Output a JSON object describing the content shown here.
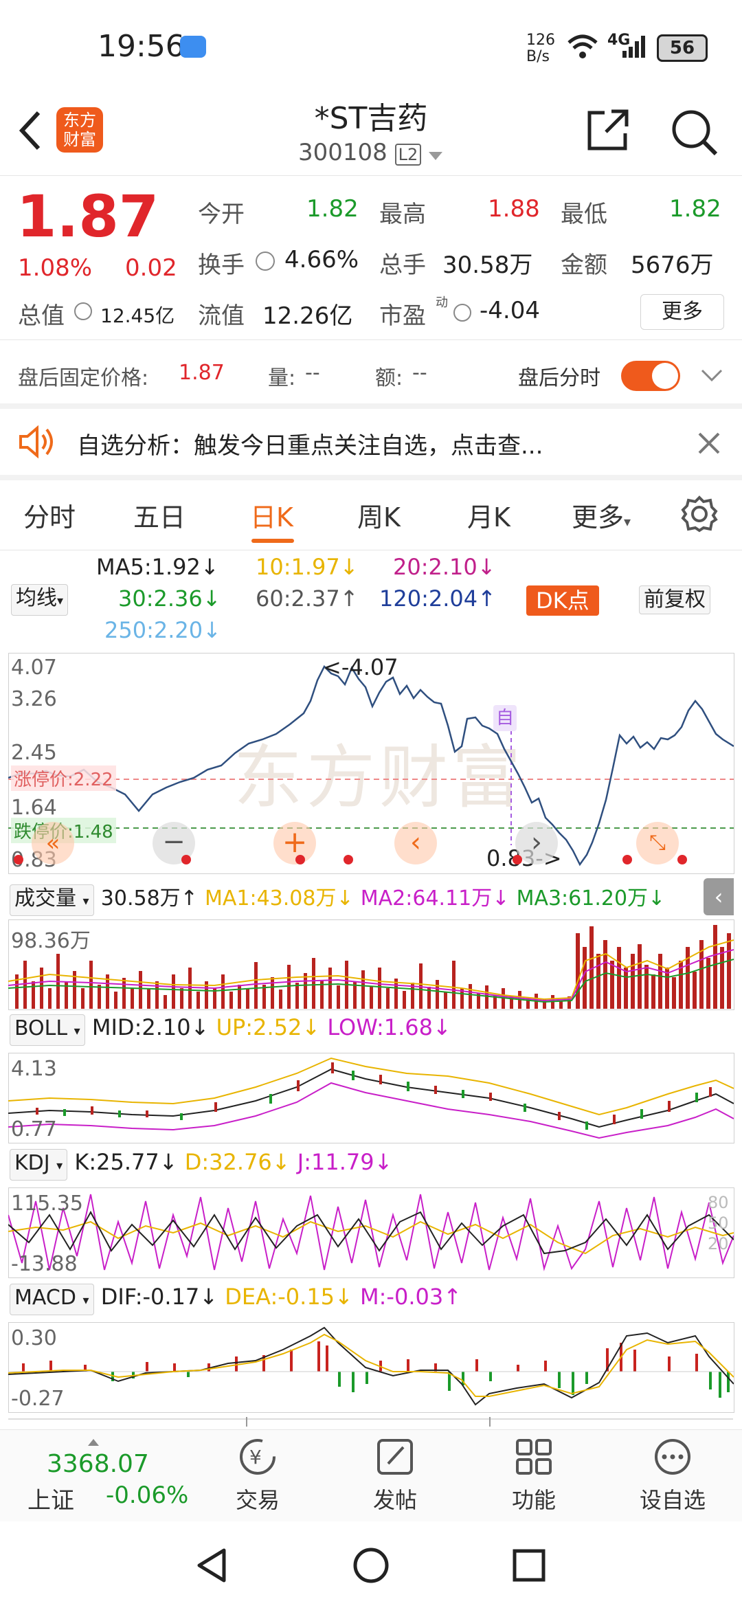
{
  "status_bar": {
    "time": "19:56",
    "net_speed_top": "126",
    "net_speed_bottom": "B/s",
    "network": "4G",
    "battery": "56"
  },
  "header": {
    "title": "*ST吉药",
    "code": "300108",
    "level": "L2",
    "logo_line1": "东方",
    "logo_line2": "财富"
  },
  "quote": {
    "price": "1.87",
    "change_pct": "1.08%",
    "change": "0.02",
    "open_label": "今开",
    "open": "1.82",
    "high_label": "最高",
    "high": "1.88",
    "low_label": "最低",
    "low": "1.82",
    "turnover_label": "换手",
    "turnover": "4.66%",
    "volume_label": "总手",
    "volume": "30.58万",
    "amount_label": "金额",
    "amount": "5676万",
    "mktcap_label": "总值",
    "mktcap": "12.45亿",
    "float_label": "流值",
    "float": "12.26亿",
    "pe_label": "市盈",
    "pe_sup": "动",
    "pe": "-4.04",
    "more_button": "更多"
  },
  "after_hours": {
    "label": "盘后固定价格:",
    "price": "1.87",
    "vol_label": "量:",
    "vol": "--",
    "amt_label": "额:",
    "amt": "--",
    "toggle_label": "盘后分时",
    "toggle_on": true
  },
  "notice": {
    "text": "自选分析：触发今日重点关注自选，点击查..."
  },
  "tabs": [
    {
      "label": "分时"
    },
    {
      "label": "五日"
    },
    {
      "label": "日K"
    },
    {
      "label": "周K"
    },
    {
      "label": "月K"
    },
    {
      "label": "更多"
    }
  ],
  "ma": {
    "selector": "均线",
    "ma5": "MA5:1.92",
    "ma10": "10:1.97",
    "ma20": "20:2.10",
    "ma30": "30:2.36",
    "ma60": "60:2.37",
    "ma120": "120:2.04",
    "ma250": "250:2.20",
    "dk_button": "DK点",
    "adjust_button": "前复权"
  },
  "kline": {
    "y_labels": [
      "4.07",
      "3.26",
      "2.45",
      "1.64",
      "0.83"
    ],
    "limit_up": "涨停价:2.22",
    "limit_down": "跌停价:1.48",
    "max_label": "<-4.07",
    "min_label": "0.83->",
    "self_marker": "自",
    "watermark": "东方财富"
  },
  "volume": {
    "selector": "成交量",
    "value": "30.58万",
    "ma1": "MA1:43.08万",
    "ma2": "MA2:64.11万",
    "ma3": "MA3:61.20万",
    "y_label": "98.36万"
  },
  "boll": {
    "selector": "BOLL",
    "mid": "MID:2.10",
    "up": "UP:2.52",
    "low": "LOW:1.68",
    "y_top": "4.13",
    "y_bottom": "0.77"
  },
  "kdj": {
    "selector": "KDJ",
    "k": "K:25.77",
    "d": "D:32.76",
    "j": "J:11.79",
    "y_top": "115.35",
    "y_bottom": "-13.88",
    "right_labels": [
      "80",
      "50",
      "20"
    ]
  },
  "macd": {
    "selector": "MACD",
    "dif": "DIF:-0.17",
    "dea": "DEA:-0.15",
    "m": "M:-0.03",
    "y_top": "0.30",
    "y_bottom": "-0.27"
  },
  "bottom_bar": {
    "index_value": "3368.07",
    "index_name": "上证",
    "index_change": "-0.06%",
    "trade": "交易",
    "post": "发帖",
    "function": "功能",
    "add_watch": "设自选"
  },
  "colors": {
    "red": "#e0262b",
    "green": "#1b9a2a",
    "orange": "#ef6a1a",
    "kline": "#2f4f7f",
    "ma_yellow": "#e8b400",
    "ma_magenta": "#c81fc8"
  }
}
